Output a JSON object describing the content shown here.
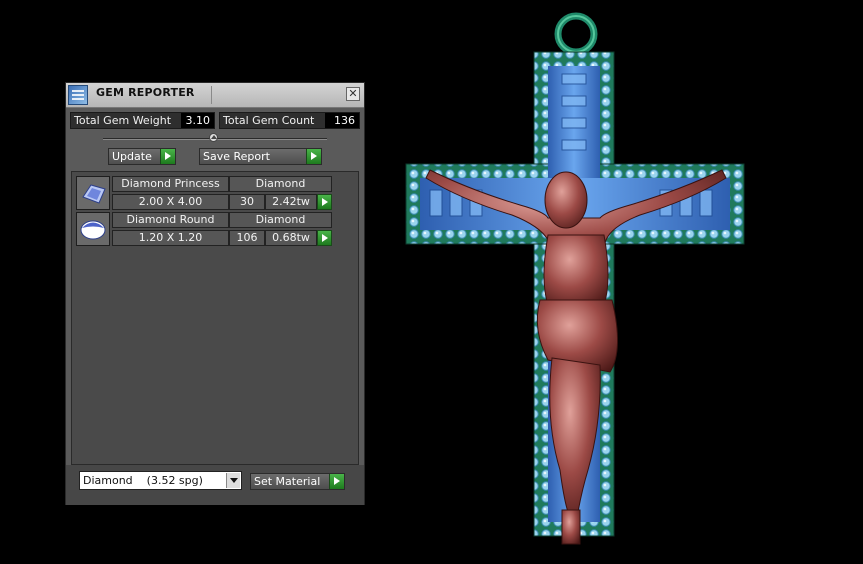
{
  "panel": {
    "title": "GEM REPORTER",
    "close_glyph": "✕",
    "total_weight_label": "Total Gem Weight",
    "total_weight_value": "3.10",
    "total_count_label": "Total Gem Count",
    "total_count_value": "136",
    "update_label": "Update",
    "save_report_label": "Save Report"
  },
  "gems": [
    {
      "icon": "princess-diamond-icon",
      "name": "Diamond Princess",
      "material": "Diamond",
      "size": "2.00 X 4.00",
      "count": "30",
      "weight": "2.42tw"
    },
    {
      "icon": "round-diamond-icon",
      "name": "Diamond Round",
      "material": "Diamond",
      "size": "1.20 X 1.20",
      "count": "106",
      "weight": "0.68tw"
    }
  ],
  "material": {
    "selected": "Diamond    (3.52 spg)",
    "set_material_label": "Set Material"
  },
  "colors": {
    "panel_bg": "#5a5a5a",
    "cross_metal": "#1f7a5c",
    "cross_inlay": "#3f7fd6",
    "figure": "#a04a48"
  }
}
